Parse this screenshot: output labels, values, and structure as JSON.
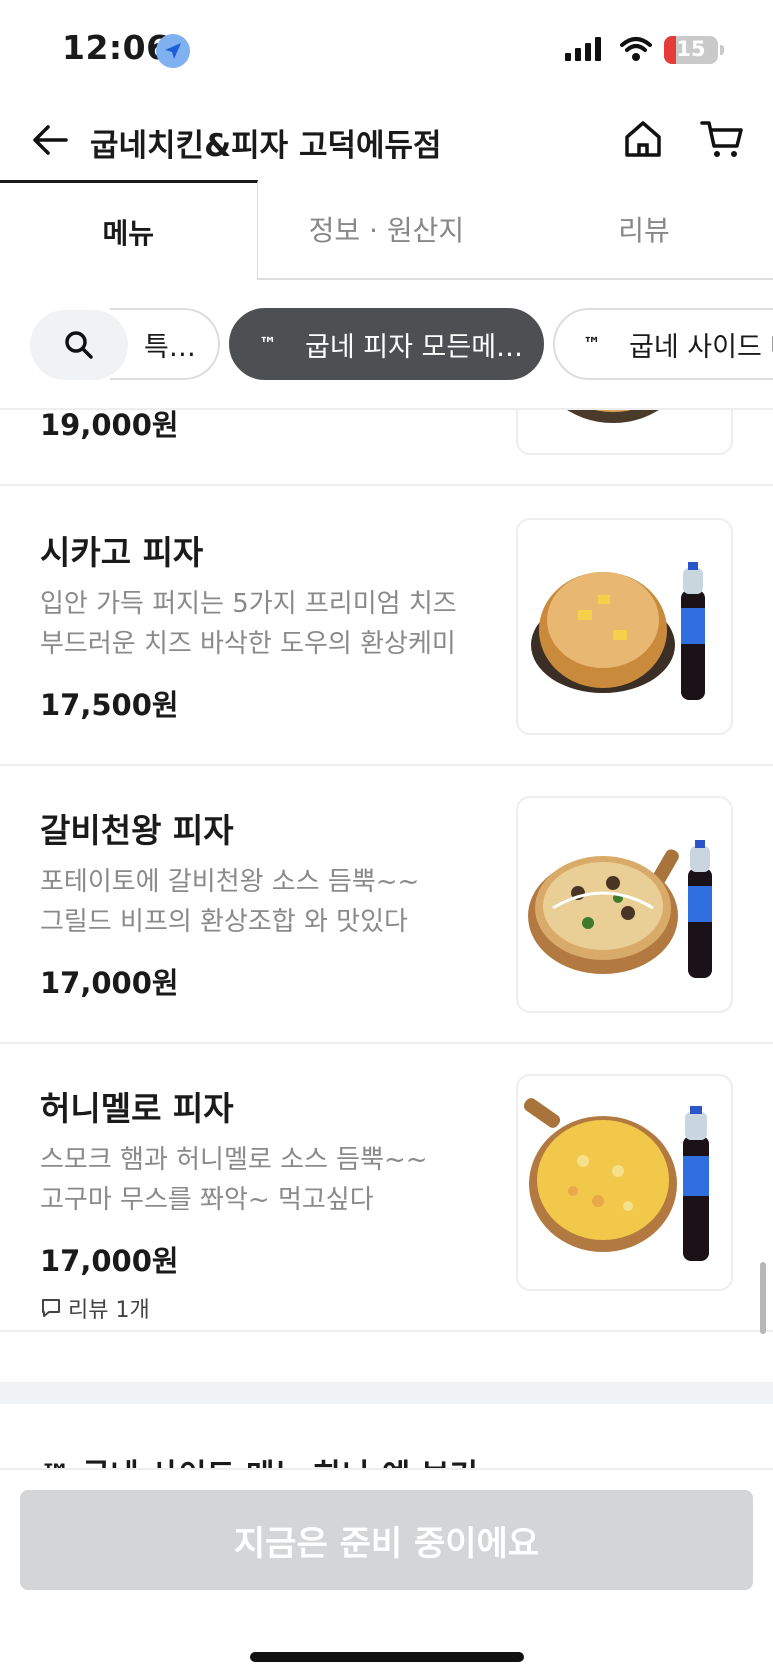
{
  "status_bar": {
    "time": "12:06",
    "battery": "15"
  },
  "header": {
    "store_name": "굽네치킨&피자 고덕에듀점"
  },
  "tabs": [
    {
      "label": "메뉴",
      "active": true
    },
    {
      "label": "정보 · 원산지",
      "active": false
    },
    {
      "label": "리뷰",
      "active": false
    }
  ],
  "chips": [
    {
      "label": "특…"
    },
    {
      "prefix": "™",
      "label": "굽네 피자 모든메…",
      "active": true
    },
    {
      "prefix": "™",
      "label": "굽네 사이드 메"
    }
  ],
  "menu_items": [
    {
      "name": "",
      "description": "",
      "price": "19,000원"
    },
    {
      "name": "시카고 피자",
      "description": "입안 가득 퍼지는 5가지 프리미엄 치즈\n부드러운 치즈 바삭한 도우의 환상케미",
      "price": "17,500원"
    },
    {
      "name": "갈비천왕 피자",
      "description": "포테이토에 갈비천왕 소스 듬뿍~~\n그릴드 비프의 환상조합 와 맛있다",
      "price": "17,000원"
    },
    {
      "name": "허니멜로 피자",
      "description": "스모크 햄과 허니멜로 소스 듬뿍~~\n고구마 무스를 쫘악~ 먹고싶다",
      "price": "17,000원",
      "review": "리뷰 1개"
    }
  ],
  "next_section_title": "™ 굽네 사이드 메뉴 하나 예 보기",
  "cta": {
    "label": "지금은 준비 중이에요"
  },
  "colors": {
    "active_chip": "#4d4f52",
    "cta_disabled": "#d4d5d7",
    "location_badge": "#7fb0f0",
    "battery_low": "#e53b3b"
  }
}
